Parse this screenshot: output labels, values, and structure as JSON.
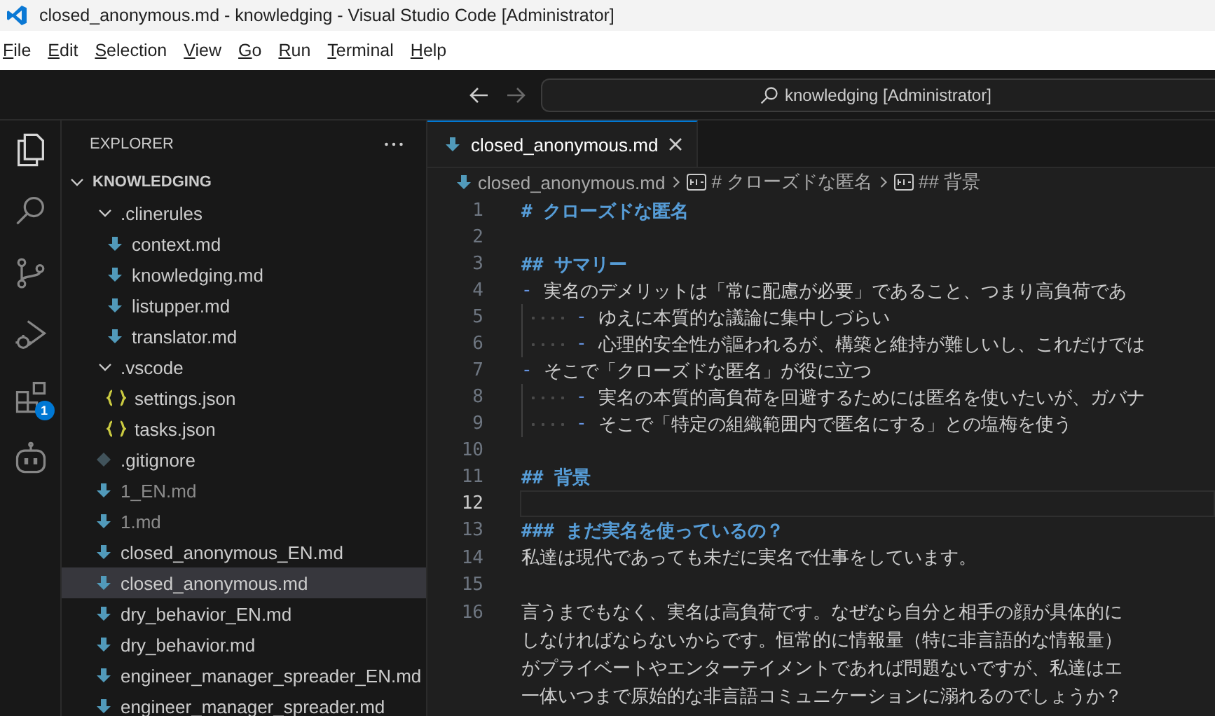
{
  "window": {
    "title": "closed_anonymous.md - knowledging - Visual Studio Code [Administrator]"
  },
  "menu": [
    {
      "label": "File"
    },
    {
      "label": "Edit"
    },
    {
      "label": "Selection"
    },
    {
      "label": "View"
    },
    {
      "label": "Go"
    },
    {
      "label": "Run"
    },
    {
      "label": "Terminal"
    },
    {
      "label": "Help"
    }
  ],
  "command_center": {
    "text": "knowledging [Administrator]"
  },
  "activity_bar": [
    {
      "kind": "explorer",
      "selected": true
    },
    {
      "kind": "search",
      "selected": false
    },
    {
      "kind": "source_control",
      "selected": false
    },
    {
      "kind": "run_debug",
      "selected": false
    },
    {
      "kind": "extensions",
      "selected": false,
      "badge": "1"
    },
    {
      "kind": "robot",
      "selected": false
    }
  ],
  "sidebar": {
    "title": "EXPLORER"
  },
  "tree": {
    "label": "KNOWLEDGING",
    "expanded": true,
    "children": [
      {
        "label": ".clinerules",
        "kind": "folder",
        "expanded": true,
        "children": [
          {
            "label": "context.md",
            "kind": "markdown",
            "selected": false,
            "dimmed": false
          },
          {
            "label": "knowledging.md",
            "kind": "markdown",
            "selected": false,
            "dimmed": false
          },
          {
            "label": "listupper.md",
            "kind": "markdown",
            "selected": false,
            "dimmed": false
          },
          {
            "label": "translator.md",
            "kind": "markdown",
            "selected": false,
            "dimmed": false
          }
        ]
      },
      {
        "label": ".vscode",
        "kind": "folder",
        "expanded": true,
        "children": [
          {
            "label": "settings.json",
            "kind": "json",
            "selected": false,
            "dimmed": false
          },
          {
            "label": "tasks.json",
            "kind": "json",
            "selected": false,
            "dimmed": false
          }
        ]
      },
      {
        "label": ".gitignore",
        "kind": "git",
        "selected": false,
        "dimmed": false
      },
      {
        "label": "1_EN.md",
        "kind": "markdown",
        "selected": false,
        "dimmed": true
      },
      {
        "label": "1.md",
        "kind": "markdown",
        "selected": false,
        "dimmed": true
      },
      {
        "label": "closed_anonymous_EN.md",
        "kind": "markdown",
        "selected": false,
        "dimmed": false
      },
      {
        "label": "closed_anonymous.md",
        "kind": "markdown",
        "selected": true,
        "dimmed": false
      },
      {
        "label": "dry_behavior_EN.md",
        "kind": "markdown",
        "selected": false,
        "dimmed": false
      },
      {
        "label": "dry_behavior.md",
        "kind": "markdown",
        "selected": false,
        "dimmed": false
      },
      {
        "label": "engineer_manager_spreader_EN.md",
        "kind": "markdown",
        "selected": false,
        "dimmed": false
      },
      {
        "label": "engineer_manager_spreader.md",
        "kind": "markdown",
        "selected": false,
        "dimmed": false
      }
    ]
  },
  "tabs": [
    {
      "label": "closed_anonymous.md",
      "selected": true
    }
  ],
  "breadcrumb": [
    {
      "kind": "file",
      "label": "closed_anonymous.md"
    },
    {
      "kind": "heading",
      "label": "# クローズドな匿名"
    },
    {
      "kind": "heading",
      "label": "## 背景"
    }
  ],
  "lines": [
    {
      "number": "1",
      "kind": "heading",
      "current": false,
      "text": "# クローズドな匿名"
    },
    {
      "number": "2",
      "kind": "blank",
      "current": false
    },
    {
      "number": "3",
      "kind": "heading",
      "current": false,
      "text": "## サマリー"
    },
    {
      "number": "4",
      "kind": "item",
      "current": false,
      "marker": "-",
      "text": "実名のデメリットは「常に配慮が必要」であること、つまり高負荷であ"
    },
    {
      "number": "5",
      "kind": "subitem",
      "current": false,
      "marker": "-",
      "text": "ゆえに本質的な議論に集中しづらい"
    },
    {
      "number": "6",
      "kind": "subitem",
      "current": false,
      "marker": "-",
      "text": "心理的安全性が謳われるが、構築と維持が難しいし、これだけでは"
    },
    {
      "number": "7",
      "kind": "item",
      "current": false,
      "marker": "-",
      "text": "そこで「クローズドな匿名」が役に立つ"
    },
    {
      "number": "8",
      "kind": "subitem",
      "current": false,
      "marker": "-",
      "text": "実名の本質的高負荷を回避するためには匿名を使いたいが、ガバナ"
    },
    {
      "number": "9",
      "kind": "subitem",
      "current": false,
      "marker": "-",
      "text": "そこで「特定の組織範囲内で匿名にする」との塩梅を使う"
    },
    {
      "number": "10",
      "kind": "blank",
      "current": false
    },
    {
      "number": "11",
      "kind": "heading",
      "current": false,
      "text": "## 背景"
    },
    {
      "number": "12",
      "kind": "blank",
      "current": true
    },
    {
      "number": "13",
      "kind": "heading",
      "current": false,
      "text": "### まだ実名を使っているの？"
    },
    {
      "number": "14",
      "kind": "paragraph",
      "current": false,
      "rows": [
        "私達は現代であっても未だに実名で仕事をしています。"
      ]
    },
    {
      "number": "15",
      "kind": "blank",
      "current": false
    },
    {
      "number": "16",
      "kind": "paragraph",
      "current": false,
      "rows": [
        "言うまでもなく、実名は高負荷です。なぜなら自分と相手の顔が具体的に",
        "しなければならないからです。恒常的に情報量（特に非言語的な情報量）",
        "がプライベートやエンターテイメントであれば問題ないですが、私達はエ",
        "一体いつまで原始的な非言語コミュニケーションに溺れるのでしょうか？"
      ]
    }
  ]
}
